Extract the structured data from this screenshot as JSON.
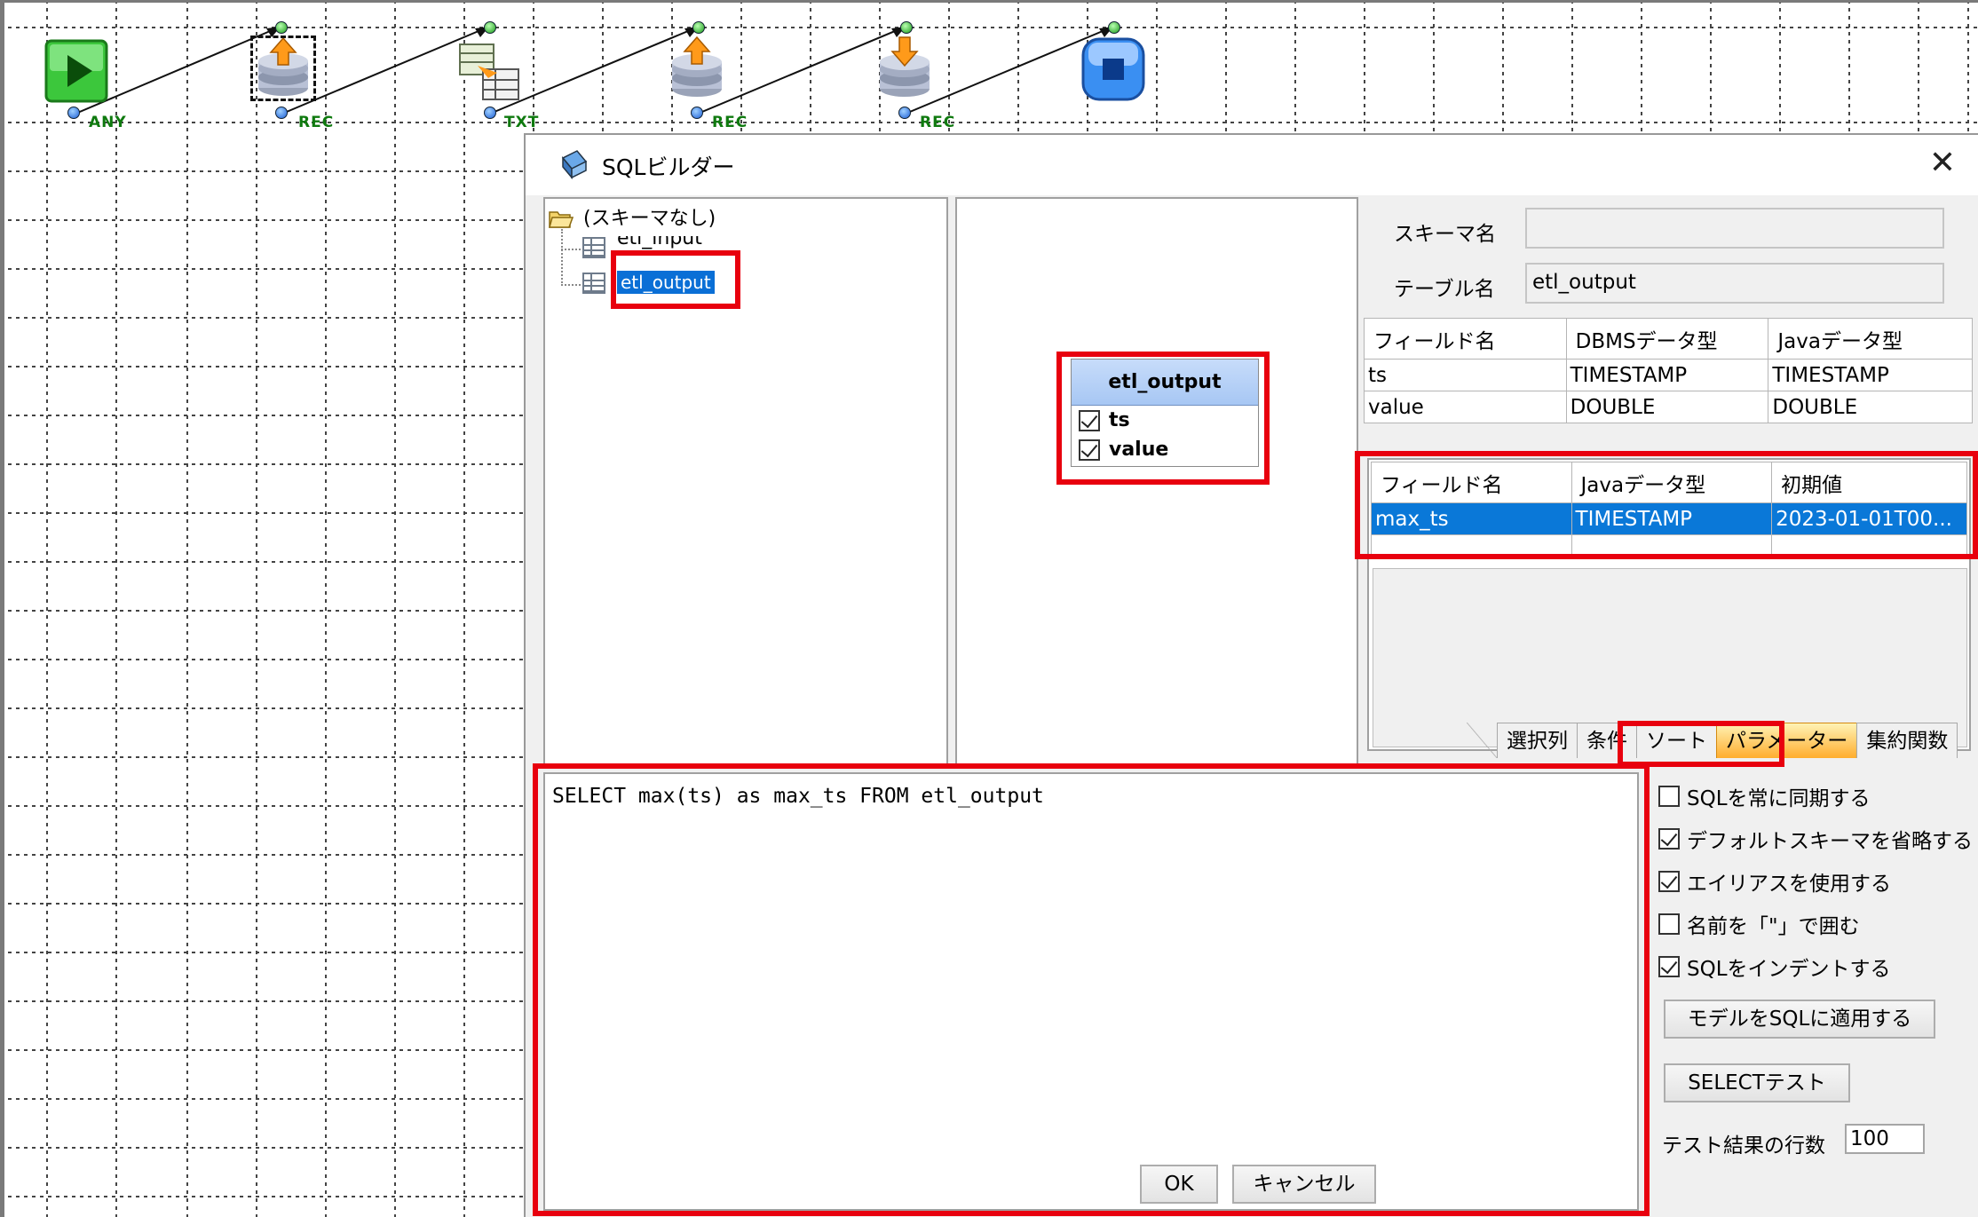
{
  "canvas": {
    "nodes": [
      {
        "name": "start-node",
        "port_label": "ANY"
      },
      {
        "name": "db-read-node",
        "port_label": "REC"
      },
      {
        "name": "text-node",
        "port_label": "TXT"
      },
      {
        "name": "db-upload-node",
        "port_label": "REC"
      },
      {
        "name": "db-download-node",
        "port_label": "REC"
      },
      {
        "name": "stop-node",
        "port_label": ""
      }
    ]
  },
  "dialog": {
    "title": "SQLビルダー",
    "close_glyph": "✕"
  },
  "tree": {
    "root": "(スキーマなし)",
    "items": [
      "etl_input",
      "etl_output"
    ]
  },
  "entity": {
    "title": "etl_output",
    "fields": [
      {
        "name": "ts",
        "checked": true
      },
      {
        "name": "value",
        "checked": true
      }
    ]
  },
  "form": {
    "schema_label": "スキーマ名",
    "schema_value": "",
    "table_label": "テーブル名",
    "table_value": "etl_output"
  },
  "fields_table": {
    "headers": [
      "フィールド名",
      "DBMSデータ型",
      "Javaデータ型"
    ],
    "rows": [
      [
        "ts",
        "TIMESTAMP",
        "TIMESTAMP"
      ],
      [
        "value",
        "DOUBLE",
        "DOUBLE"
      ]
    ]
  },
  "params_table": {
    "headers": [
      "フィールド名",
      "Javaデータ型",
      "初期値"
    ],
    "rows": [
      [
        "max_ts",
        "TIMESTAMP",
        "2023-01-01T00..."
      ]
    ]
  },
  "tabs": [
    "選択列",
    "条件",
    "ソート",
    "パラメーター",
    "集約関数"
  ],
  "active_tab": "パラメーター",
  "sql_text": "SELECT max(ts) as max_ts FROM etl_output",
  "options": [
    {
      "label": "SQLを常に同期する",
      "checked": false
    },
    {
      "label": "デフォルトスキーマを省略する",
      "checked": true
    },
    {
      "label": "エイリアスを使用する",
      "checked": true
    },
    {
      "label": "名前を「\"」で囲む",
      "checked": false
    },
    {
      "label": "SQLをインデントする",
      "checked": true
    }
  ],
  "buttons": {
    "apply_model": "モデルをSQLに適用する",
    "select_test": "SELECTテスト",
    "ok": "OK",
    "cancel": "キャンセル"
  },
  "test_rows": {
    "label": "テスト結果の行数",
    "value": "100"
  },
  "colors": {
    "highlight_red": "#e8000e",
    "selection_blue": "#0a78d8",
    "active_tab_orange": "#ffad2e"
  }
}
